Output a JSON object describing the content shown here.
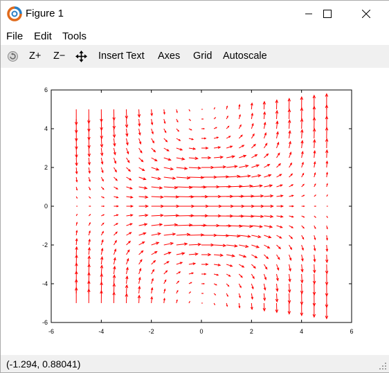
{
  "window": {
    "title": "Figure 1"
  },
  "menu": {
    "file": "File",
    "edit": "Edit",
    "tools": "Tools"
  },
  "toolbar": {
    "zoom_in": "Z+",
    "zoom_out": "Z−",
    "insert_text": "Insert Text",
    "axes": "Axes",
    "grid": "Grid",
    "autoscale": "Autoscale"
  },
  "status": {
    "coords": "(-1.294, 0.88041)"
  },
  "icons": [
    "octave-logo-icon",
    "minimize-icon",
    "maximize-icon",
    "close-icon",
    "rotate-icon",
    "pan-icon",
    "resize-grip-icon"
  ],
  "chart_data": {
    "type": "quiver",
    "title": "",
    "xlabel": "",
    "ylabel": "",
    "xlim": [
      -6,
      6
    ],
    "ylim": [
      -6,
      6
    ],
    "xticks": [
      "-6",
      "-4",
      "-2",
      "0",
      "2",
      "4",
      "6"
    ],
    "yticks": [
      "6",
      "4",
      "2",
      "0",
      "-2",
      "-4",
      "-6"
    ],
    "arrow_color": "#ff0000",
    "grid_x": [
      -5,
      5,
      21
    ],
    "grid_y": [
      -5,
      5,
      21
    ],
    "field": "u = exp(-(x^2+y^2)/8); v = x*y/25 (approximate)"
  }
}
